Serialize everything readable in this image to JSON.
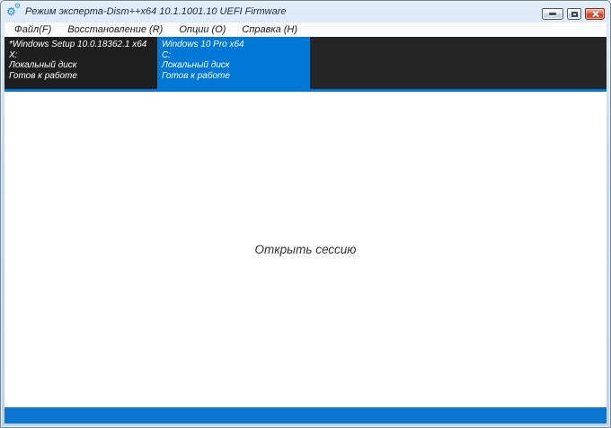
{
  "window": {
    "title": "Режим эксперта-Dism++x64 10.1.1001.10 UEFI Firmware"
  },
  "menu": {
    "items": [
      {
        "label": "Файл(F)"
      },
      {
        "label": "Восстановление (R)"
      },
      {
        "label": "Опции (O)"
      },
      {
        "label": "Справка (H)"
      }
    ]
  },
  "tabs": [
    {
      "title": "*Windows Setup 10.0.18362.1 x64",
      "drive": "X:",
      "disk_type": "Локальный диск",
      "status": "Готов к работе",
      "selected": false
    },
    {
      "title": "Windows 10 Pro x64",
      "drive": "C:",
      "disk_type": "Локальный диск",
      "status": "Готов к работе",
      "selected": true
    }
  ],
  "content": {
    "open_session_label": "Открыть сессию"
  },
  "icons": {
    "app_icon": "gears-icon",
    "gear_glyph": "⚙"
  },
  "colors": {
    "accent_blue": "#0078d7",
    "tab_strip_dark": "#262626",
    "unselected_tab_dark": "#1f1f1f",
    "statusbar_blue": "#0a76d1",
    "titlebar_light_blue": "#c3d6ec",
    "close_button_red": "#c74729"
  }
}
